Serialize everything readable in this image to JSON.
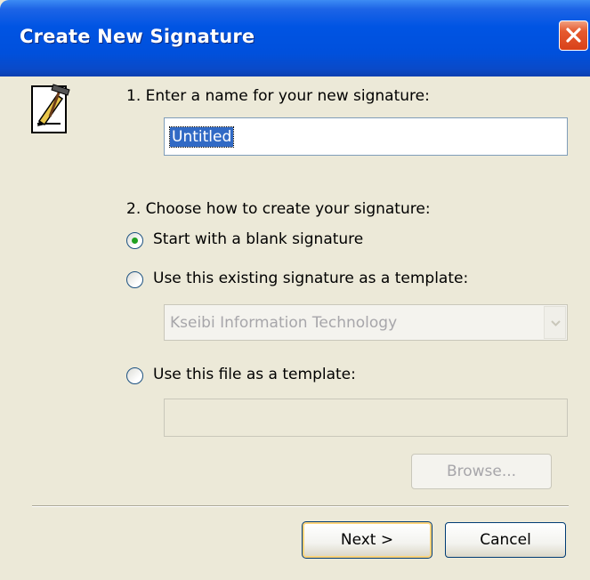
{
  "window": {
    "title": "Create New Signature"
  },
  "step1": {
    "label": "1. Enter a name for your new signature:",
    "name_value": "Untitled"
  },
  "step2": {
    "label": "2. Choose how to create your signature:",
    "options": [
      {
        "label": "Start with a blank signature",
        "selected": true
      },
      {
        "label": "Use this existing signature as a template:",
        "selected": false
      },
      {
        "label": "Use this file as a template:",
        "selected": false
      }
    ],
    "existing_signature_selected": "Kseibi Information Technology",
    "file_path_value": ""
  },
  "buttons": {
    "browse": "Browse...",
    "next": "Next >",
    "cancel": "Cancel"
  },
  "icons": {
    "app": "signature-pencil-hammer-icon",
    "close": "close-icon",
    "dropdown": "chevron-down-icon"
  },
  "colors": {
    "titlebar": "#0054e3",
    "dialog_bg": "#ece9d8",
    "selection": "#316ac5",
    "close": "#e65a2e",
    "radio_dot": "#21a121"
  }
}
